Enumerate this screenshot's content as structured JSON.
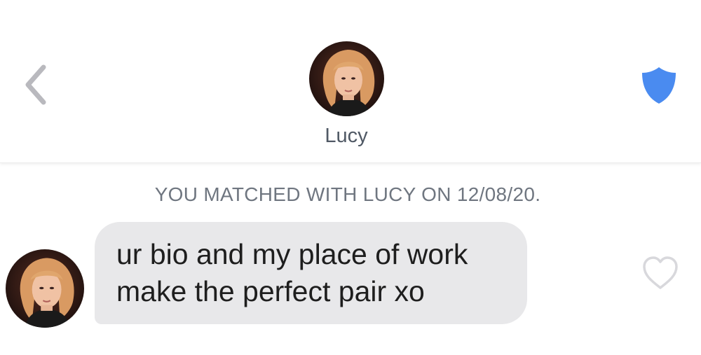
{
  "header": {
    "back_icon": "chevron-left-icon",
    "match_name": "Lucy",
    "avatar_icon": "profile-photo",
    "safety_icon": "shield-icon",
    "accent_color": "#4a8bf0"
  },
  "conversation": {
    "match_notice": "YOU MATCHED WITH LUCY ON 12/08/20.",
    "messages": [
      {
        "sender": "Lucy",
        "text": "ur bio and my place of work\nmake the perfect pair xo",
        "bubble_color": "#e8e8ea",
        "like_icon": "heart-outline-icon"
      }
    ]
  }
}
